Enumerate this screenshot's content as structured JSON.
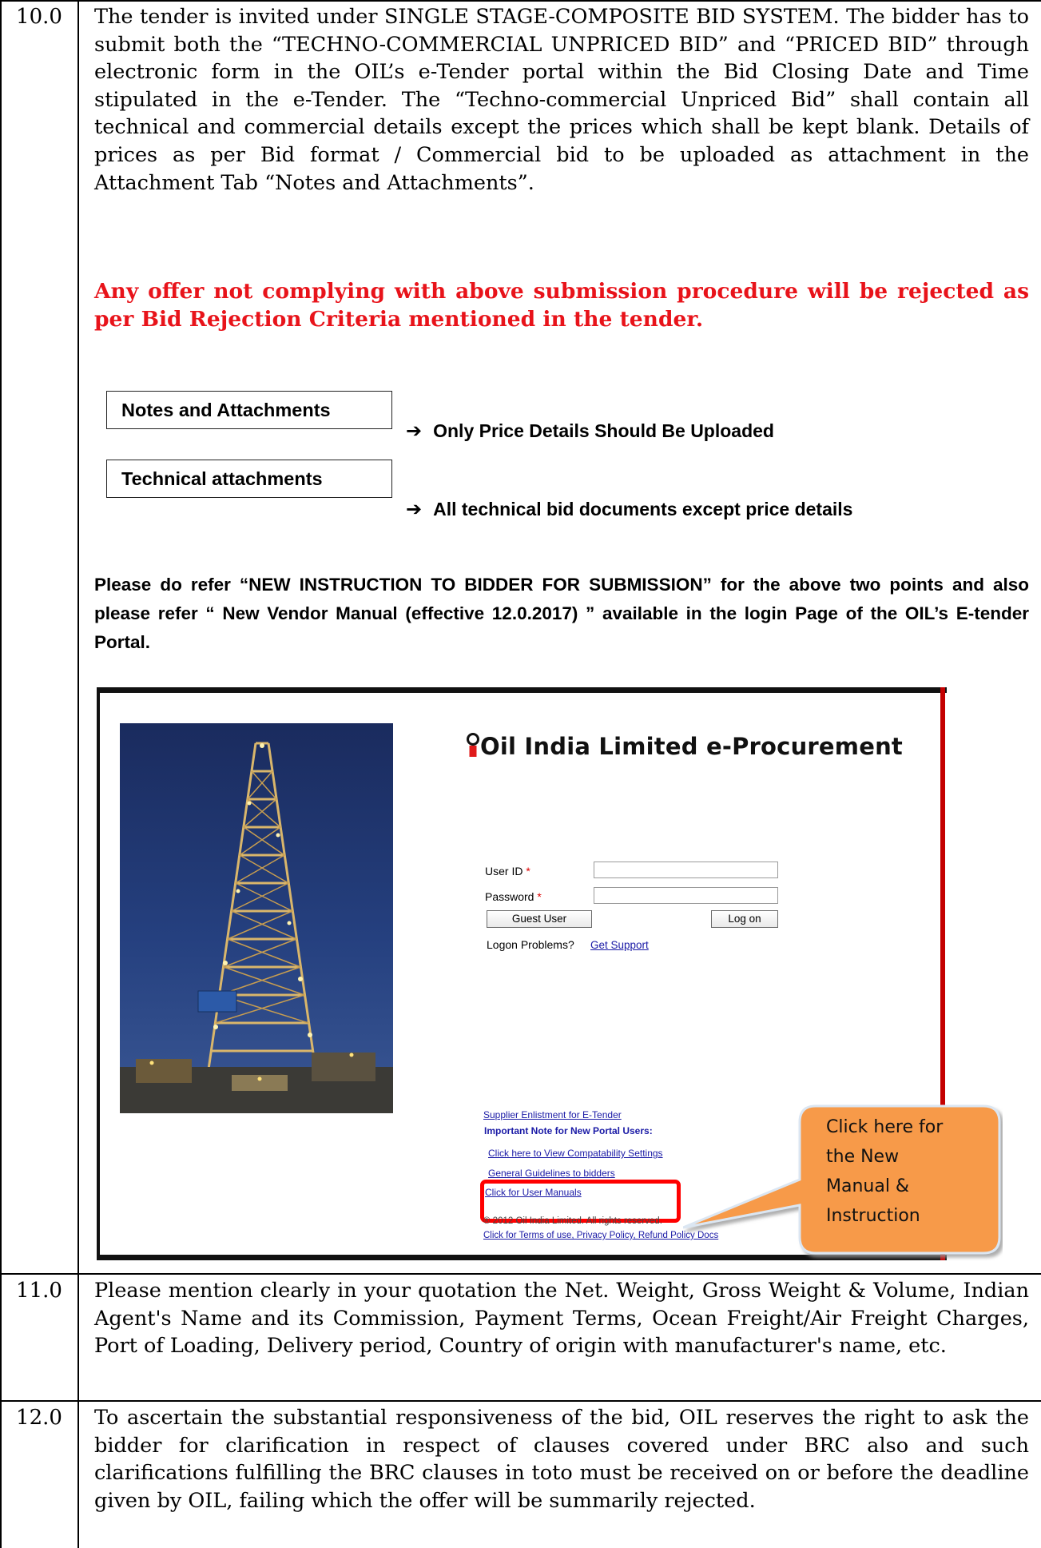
{
  "rows": [
    {
      "number": "10.0",
      "paragraph": "The tender is invited under SINGLE STAGE-COMPOSITE BID SYSTEM. The bidder has to submit both the “TECHNO-COMMERCIAL UNPRICED BID” and “PRICED BID” through electronic form in the OIL’s e-Tender portal within the Bid Closing Date and Time stipulated in the e-Tender. The “Techno-commercial Unpriced Bid” shall contain all technical and commercial details except the prices which shall be kept blank. Details of prices as per Bid format / Commercial bid to be uploaded as attachment in the Attachment Tab “Notes and Attachments”.",
      "warning": "Any offer not complying with above submission procedure will be rejected as per Bid Rejection Criteria mentioned in the tender.",
      "tabs": [
        {
          "label": "Notes and Attachments",
          "note": "Only Price Details Should Be Uploaded"
        },
        {
          "label": "Technical attachments",
          "note": "All technical bid documents except price details"
        }
      ],
      "arrow": "➔",
      "refer": "Please do refer “NEW INSTRUCTION TO BIDDER FOR SUBMISSION” for the above two points and also please refer “ New Vendor  Manual (effective 12.0.2017) ” available in the login Page of the OIL’s E-tender Portal."
    },
    {
      "number": "11.0",
      "paragraph": "Please mention clearly in your quotation the Net. Weight, Gross Weight & Volume, Indian Agent's Name and its Commission, Payment Terms, Ocean Freight/Air Freight Charges, Port of Loading, Delivery period, Country of origin with manufacturer's name, etc."
    },
    {
      "number": "12.0",
      "paragraph": "To ascertain the substantial responsiveness of the bid, OIL reserves the right to ask the bidder for clarification in respect of clauses covered under BRC also and such clarifications fulfilling the BRC clauses in toto must be received on or before the deadline given by OIL, failing which the offer will be summarily rejected."
    }
  ],
  "portal": {
    "title": "Oil India Limited e-Procurement",
    "user_id_label": "User ID",
    "password_label": "Password",
    "required_mark": "*",
    "user_id_value": "",
    "password_value": "",
    "guest_button": "Guest User",
    "logon_button": "Log on",
    "logon_problems": "Logon Problems?",
    "get_support": "Get Support",
    "links": {
      "supplier_enlistment": "Supplier Enlistment for E-Tender",
      "important_note": "Important Note for New Portal Users:",
      "compatibility": "Click here to View Compatability Settings",
      "guidelines": "General Guidelines to bidders",
      "user_manuals": "Click for User Manuals",
      "terms": "Click for Terms of use, Privacy Policy, Refund Policy Docs"
    },
    "copyright": "® 2012 Oil India Limited. All rights reserved."
  },
  "callout": {
    "lines": [
      "Click here for",
      "the New",
      "Manual &",
      "Instruction"
    ],
    "fill": "#f79a48",
    "highlight_color": "#ff0000"
  }
}
